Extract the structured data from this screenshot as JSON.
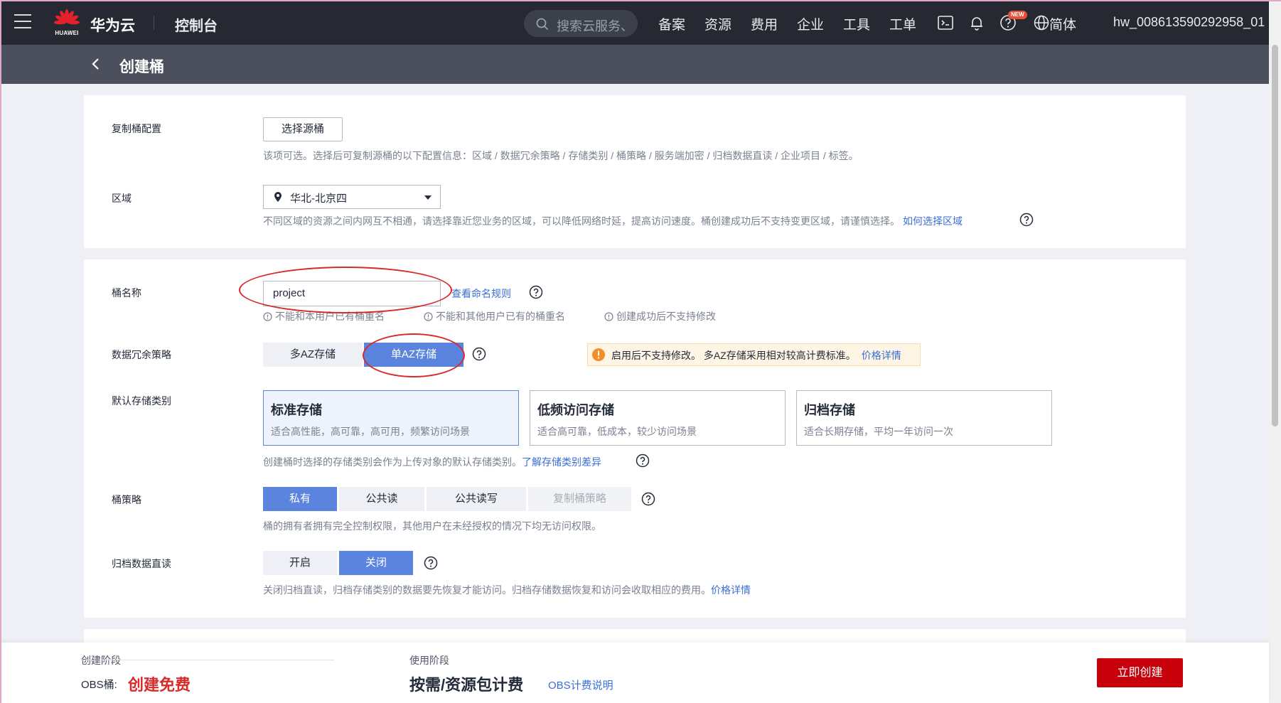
{
  "nav": {
    "brand": "华为云",
    "logo_text": "HUAWEI",
    "console": "控制台",
    "search_placeholder": "搜索云服务、",
    "links": [
      "备案",
      "资源",
      "费用",
      "企业",
      "工具",
      "工单"
    ],
    "new_badge": "NEW",
    "language": "简体",
    "user": "hw_008613590292958_01"
  },
  "page": {
    "title": "创建桶"
  },
  "config": {
    "copy_label": "复制桶配置",
    "copy_button": "选择源桶",
    "copy_hint": "该项可选。选择后可复制源桶的以下配置信息：区域 / 数据冗余策略 / 存储类别 / 桶策略 / 服务端加密 / 归档数据直读 / 企业项目 / 标签。",
    "region_label": "区域",
    "region_value": "华北-北京四",
    "region_hint": "不同区域的资源之间内网互不相通，请选择靠近您业务的区域，可以降低网络时延，提高访问速度。桶创建成功后不支持变更区域，请谨慎选择。",
    "region_link": "如何选择区域"
  },
  "bucket": {
    "name_label": "桶名称",
    "name_value": "project",
    "naming_link": "查看命名规则",
    "rules": [
      "不能和本用户已有桶重名",
      "不能和其他用户已有的桶重名",
      "创建成功后不支持修改"
    ],
    "redundancy_label": "数据冗余策略",
    "redundancy_options": [
      "多AZ存储",
      "单AZ存储"
    ],
    "warning_text": "启用后不支持修改。 多AZ存储采用相对较高计费标准。",
    "warning_link": "价格详情",
    "storage_label": "默认存储类别",
    "storage_types": [
      {
        "title": "标准存储",
        "desc": "适合高性能，高可靠，高可用，频繁访问场景"
      },
      {
        "title": "低频访问存储",
        "desc": "适合高可靠，低成本，较少访问场景"
      },
      {
        "title": "归档存储",
        "desc": "适合长期存储，平均一年访问一次"
      }
    ],
    "storage_hint": "创建桶时选择的存储类别会作为上传对象的默认存储类别。",
    "storage_link": "了解存储类别差异",
    "policy_label": "桶策略",
    "policy_options": [
      "私有",
      "公共读",
      "公共读写",
      "复制桶策略"
    ],
    "policy_hint": "桶的拥有者拥有完全控制权限，其他用户在未经授权的情况下均无访问权限。",
    "archive_label": "归档数据直读",
    "archive_options": [
      "开启",
      "关闭"
    ],
    "archive_hint": "关闭归档直读，归档存储类别的数据要先恢复才能访问。归档存储数据恢复和访问会收取相应的费用。",
    "archive_link": "价格详情"
  },
  "footer": {
    "create_stage_label": "创建阶段",
    "obs_label": "OBS桶:",
    "create_price": "创建免费",
    "use_stage_label": "使用阶段",
    "use_price": "按需/资源包计费",
    "billing_link": "OBS计费说明",
    "create_button": "立即创建"
  },
  "colors": {
    "topbar": "#262932",
    "subheader": "#4c505c",
    "accent": "#5a84de",
    "link": "#3a6ed4",
    "primary_button": "#c7000b",
    "annotation": "#d92a2a"
  }
}
